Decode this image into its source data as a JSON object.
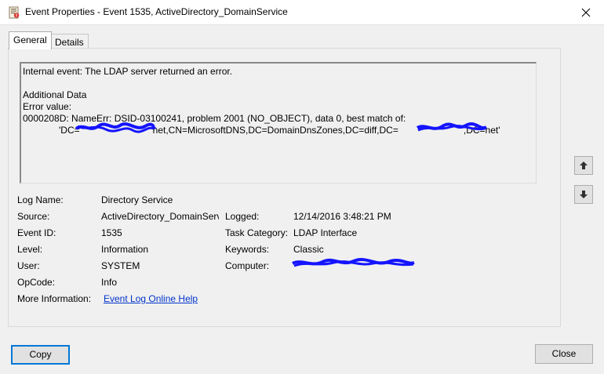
{
  "window": {
    "title": "Event Properties - Event 1535, ActiveDirectory_DomainService"
  },
  "tabs": [
    {
      "label": "General",
      "active": true
    },
    {
      "label": "Details",
      "active": false
    }
  ],
  "description": {
    "line1": "Internal event: The LDAP server returned an error.",
    "line2": "Additional Data",
    "line3": "Error value:",
    "line4": "0000208D: NameErr: DSID-03100241, problem 2001 (NO_OBJECT), data 0, best match of:",
    "line5_part1": "'DC=",
    "line5_part2": "net,CN=MicrosoftDNS,DC=DomainDnsZones,DC=diff,DC=",
    "line5_part3": ",DC=net'"
  },
  "fields": {
    "log_name_label": "Log Name:",
    "log_name_value": "Directory Service",
    "source_label": "Source:",
    "source_value": "ActiveDirectory_DomainServ",
    "logged_label": "Logged:",
    "logged_value": "12/14/2016 3:48:21 PM",
    "event_id_label": "Event ID:",
    "event_id_value": "1535",
    "task_category_label": "Task Category:",
    "task_category_value": "LDAP Interface",
    "level_label": "Level:",
    "level_value": "Information",
    "keywords_label": "Keywords:",
    "keywords_value": "Classic",
    "user_label": "User:",
    "user_value": "SYSTEM",
    "computer_label": "Computer:",
    "opcode_label": "OpCode:",
    "opcode_value": "Info",
    "more_info_label": "More Information:",
    "more_info_link": "Event Log Online Help"
  },
  "buttons": {
    "copy": "Copy",
    "close": "Close"
  },
  "colors": {
    "redaction": "#1414ff",
    "link": "#0033cc",
    "focus_border": "#0078d7"
  },
  "icons": {
    "app": "event-viewer-icon",
    "close": "close-icon",
    "up": "arrow-up-icon",
    "down": "arrow-down-icon"
  }
}
